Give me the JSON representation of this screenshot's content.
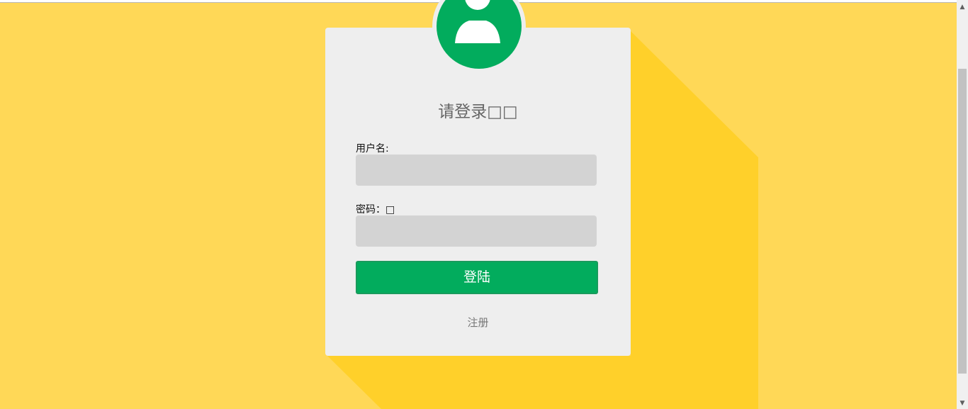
{
  "page": {
    "background_color": "#ffd857",
    "shadow_color": "#ffd02a"
  },
  "login": {
    "avatar_icon": "user-icon",
    "avatar_color": "#02ac5d",
    "title": "请登录□□",
    "username_label": "用户名:",
    "username_value": "",
    "password_label": "密码：□",
    "password_value": "",
    "login_button": "登陆",
    "register_link": "注册"
  },
  "scrollbar": {
    "up_icon": "arrow-up-icon",
    "down_icon": "arrow-down-icon"
  }
}
